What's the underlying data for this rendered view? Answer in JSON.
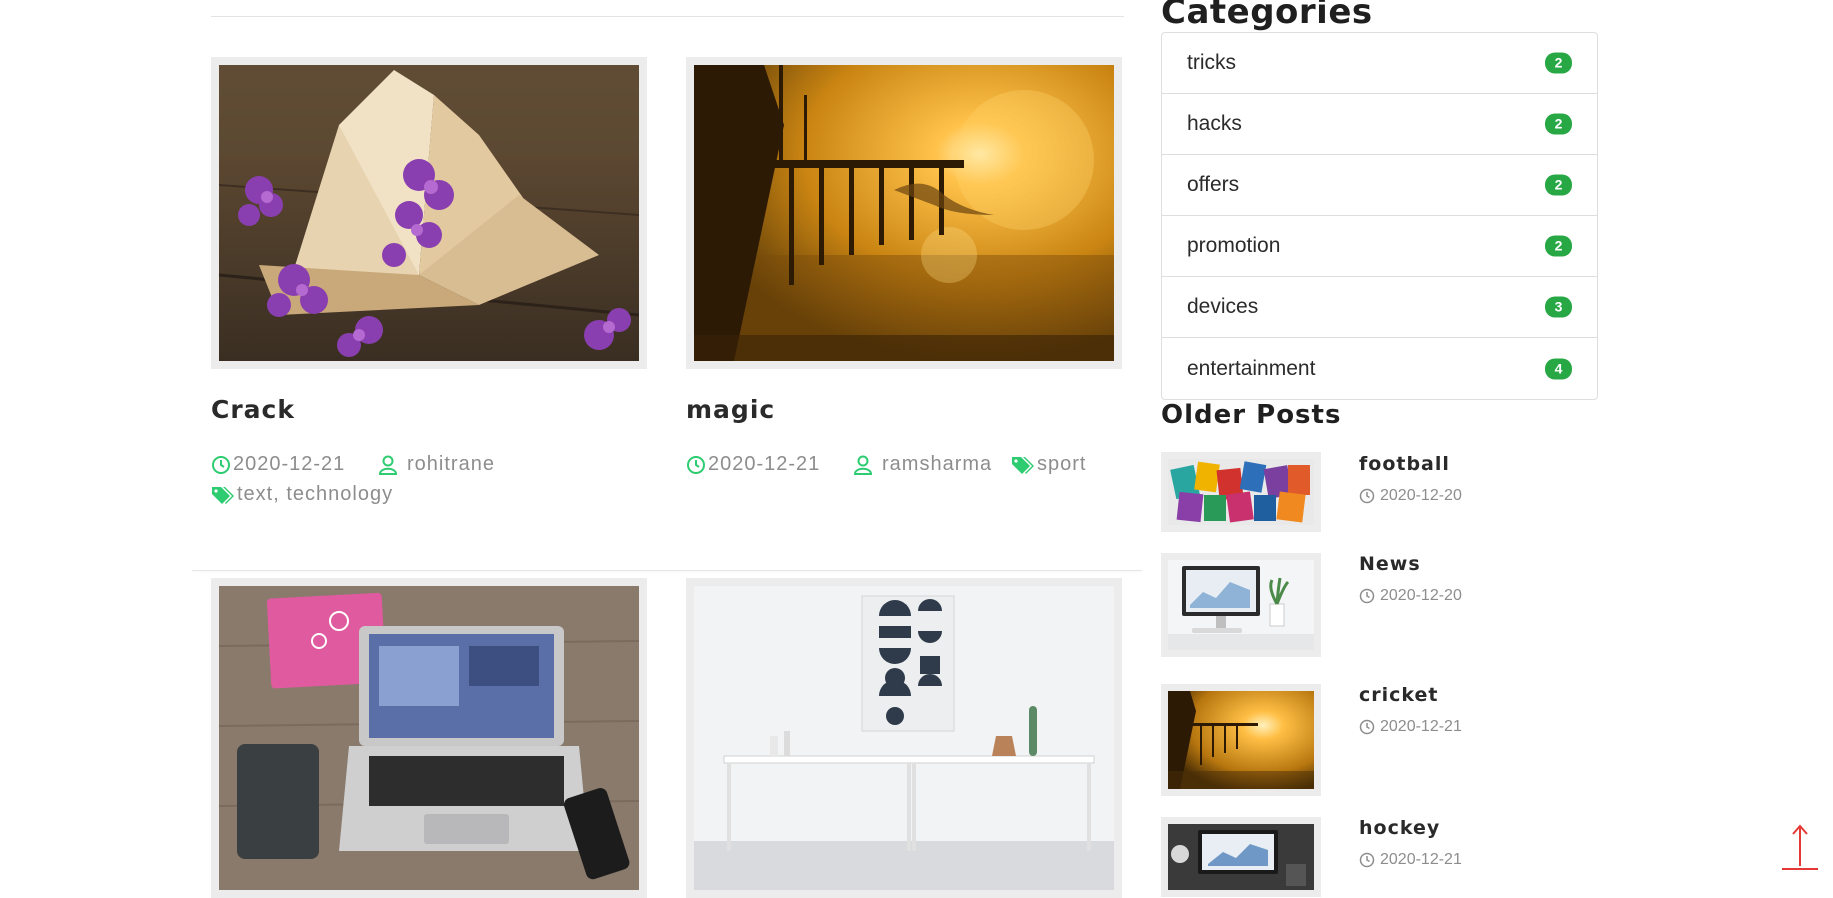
{
  "posts": [
    {
      "title": "Crack",
      "date": "2020-12-21",
      "author": "rohitrane",
      "tags": "text, technology"
    },
    {
      "title": "magic",
      "date": "2020-12-21",
      "author": "ramsharma",
      "tags": "sport"
    }
  ],
  "sidebar": {
    "categories_heading": "Categories",
    "categories": [
      {
        "name": "tricks",
        "count": "2"
      },
      {
        "name": "hacks",
        "count": "2"
      },
      {
        "name": "offers",
        "count": "2"
      },
      {
        "name": "promotion",
        "count": "2"
      },
      {
        "name": "devices",
        "count": "3"
      },
      {
        "name": "entertainment",
        "count": "4"
      }
    ],
    "older_heading": "Older Posts",
    "older_posts": [
      {
        "title": "football",
        "date": "2020-12-20"
      },
      {
        "title": "News",
        "date": "2020-12-20"
      },
      {
        "title": "cricket",
        "date": "2020-12-21"
      },
      {
        "title": "hockey",
        "date": "2020-12-21"
      }
    ]
  },
  "colors": {
    "accent": "#2ecc71",
    "badge": "#28a745",
    "scroll_arrow": "#e53935"
  },
  "icons": {
    "date": "clock-icon",
    "author": "user-icon",
    "tags": "tag-icon",
    "scroll": "arrow-up-icon"
  }
}
